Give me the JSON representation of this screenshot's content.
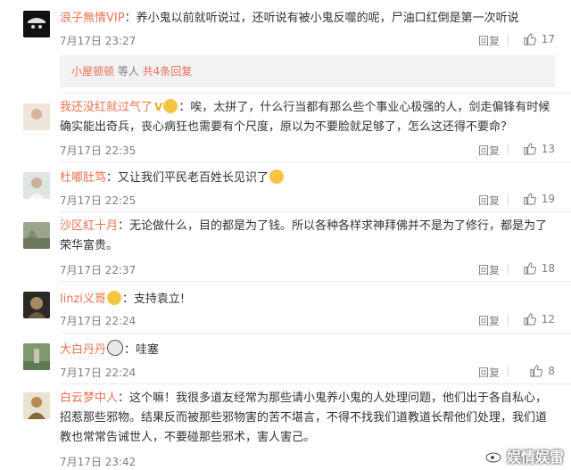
{
  "comments": [
    {
      "user": "浪子無情VIP",
      "badge": "",
      "emoji": "",
      "text": "：养小鬼以前就听说过，还听说有被小鬼反噬的呢，尸油口红倒是第一次听说",
      "time": "7月17日 23:27",
      "reply": "回复",
      "likes": "17"
    },
    {
      "user": "我还没红就过气了",
      "badge": "V",
      "emoji": "smile-emoji",
      "text": "：唉，太拼了，什么行当都有那么些个事业心极强的人，剑走偏锋有时候确实能出奇兵，丧心病狂也需要有个尺度，原以为不要脸就足够了，怎么这还得不要命？",
      "time": "7月17日 22:35",
      "reply": "回复",
      "likes": "13"
    },
    {
      "user": "杜嘟肚笃",
      "badge": "",
      "emoji": "",
      "text": "：又让我们平民老百姓长见识了",
      "time": "7月17日 22:25",
      "reply": "回复",
      "likes": "19"
    },
    {
      "user": "沙区紅十月",
      "badge": "",
      "emoji": "",
      "text": "：无论做什么，目的都是为了钱。所以各种各样求神拜佛并不是为了修行，都是为了荣华富贵。",
      "time": "7月17日 22:37",
      "reply": "回复",
      "likes": "18"
    },
    {
      "user": "linzi义哥",
      "badge": "",
      "emoji": "",
      "text": "：支持袁立!",
      "time": "7月17日 22:24",
      "reply": "回复",
      "likes": "12"
    },
    {
      "user": "大白丹丹",
      "badge": "",
      "emoji": "",
      "text": "：哇塞",
      "time": "7月17日 22:24",
      "reply": "回复",
      "likes": "8"
    },
    {
      "user": "白云梦中人",
      "badge": "",
      "emoji": "",
      "text": "：这个嘛！我很多道友经常为那些请小鬼养小鬼的人处理问题，他们出于各自私心，招惹那些邪物。结果反而被那些邪物害的苦不堪言，不得不找我们道教道长帮他们处理，我们道教也常常告诫世人，不要碰那些邪术，害人害己。",
      "time": "7月17日 23:42",
      "reply": "回复",
      "likes": ""
    }
  ],
  "subreply": {
    "name": "小屋顿顿",
    "mid": " 等人 ",
    "count": "共4条回复"
  },
  "watermark": "娱情娱雷"
}
